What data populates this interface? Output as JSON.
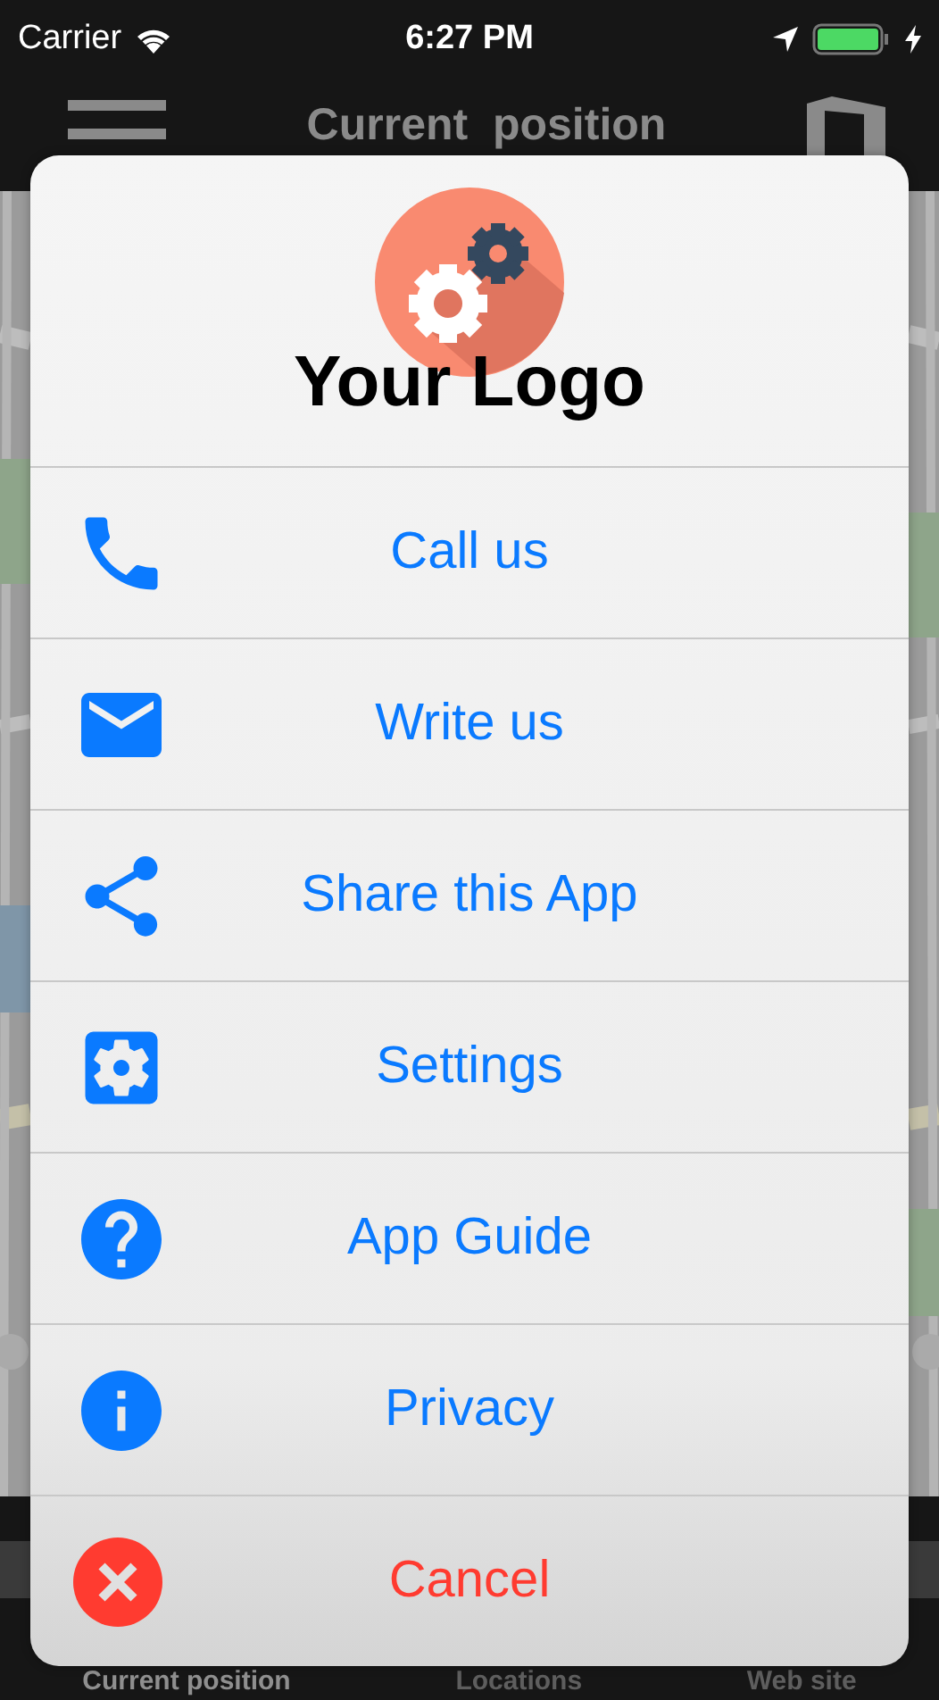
{
  "status_bar": {
    "carrier": "Carrier",
    "time": "6:27 PM"
  },
  "nav_bar": {
    "title": "Current  position"
  },
  "sheet": {
    "logo_text": "Your Logo",
    "actions": [
      {
        "kind": "phone",
        "label": "Call us"
      },
      {
        "kind": "mail",
        "label": "Write us"
      },
      {
        "kind": "share",
        "label": "Share this App"
      },
      {
        "kind": "settings",
        "label": "Settings"
      },
      {
        "kind": "help",
        "label": "App Guide"
      },
      {
        "kind": "info",
        "label": "Privacy"
      }
    ],
    "cancel": {
      "label": "Cancel"
    }
  },
  "tab_bar": [
    {
      "label": "Current position",
      "selected": true
    },
    {
      "label": "Locations",
      "selected": false
    },
    {
      "label": "Web site",
      "selected": false
    }
  ]
}
